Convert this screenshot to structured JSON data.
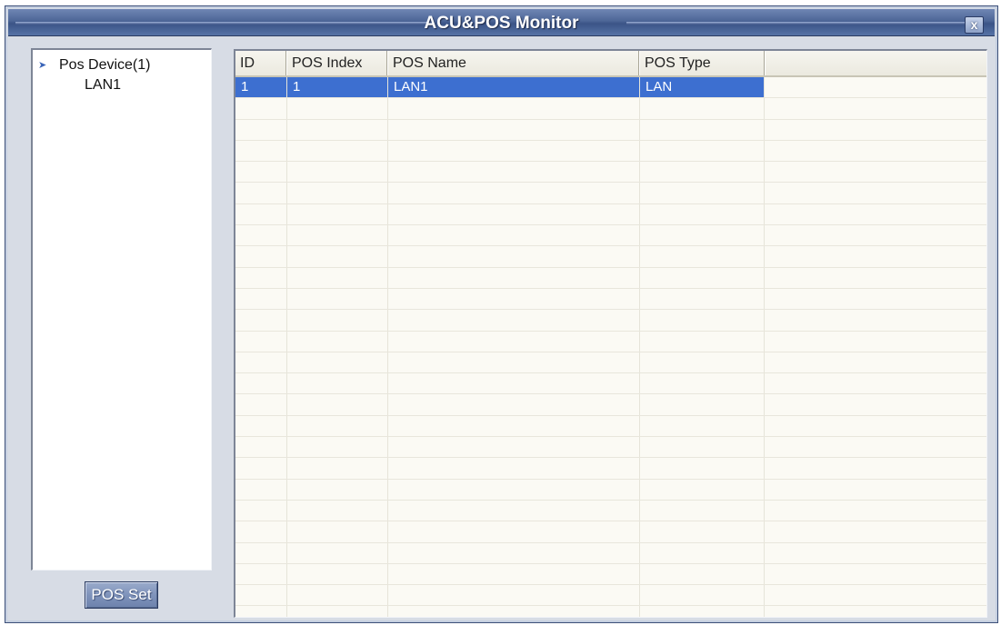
{
  "window": {
    "title": "ACU&POS Monitor",
    "close_glyph": "x"
  },
  "tree": {
    "root_label": "Pos Device(1)",
    "root_icon": "arrow-right-icon",
    "children": [
      "LAN1"
    ]
  },
  "buttons": {
    "pos_set": "POS Set"
  },
  "table": {
    "columns": [
      "ID",
      "POS Index",
      "POS Name",
      "POS Type"
    ],
    "rows": [
      {
        "id": "1",
        "pos_index": "1",
        "pos_name": "LAN1",
        "pos_type": "LAN",
        "selected": true
      }
    ],
    "selection_color": "#3d6fd0"
  }
}
